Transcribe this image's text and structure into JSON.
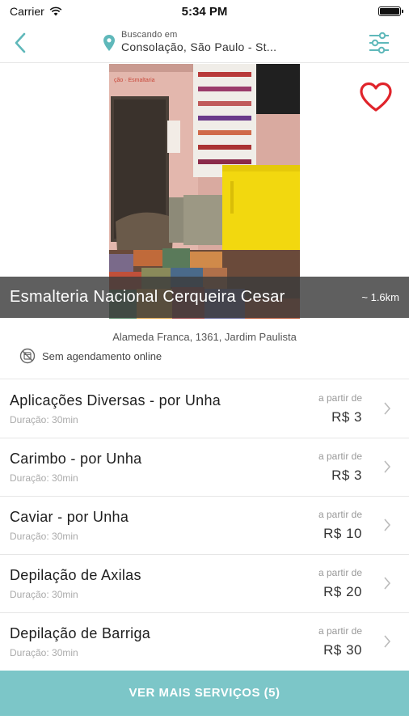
{
  "status_bar": {
    "carrier": "Carrier",
    "time": "5:34 PM"
  },
  "nav": {
    "location_label": "Buscando em",
    "location_value": "Consolação, São Paulo - St...",
    "accent_color": "#5fb8ba"
  },
  "salon": {
    "name": "Esmalteria Nacional Cerqueira Cesar",
    "distance": "~ 1.6km",
    "address": "Alameda Franca, 1361, Jardim Paulista",
    "booking_status": "Sem agendamento online",
    "favorite_color": "#e0242b"
  },
  "services": [
    {
      "name": "Aplicações Diversas - por Unha",
      "duration": "Duração: 30min",
      "from_label": "a partir de",
      "price": "R$ 3"
    },
    {
      "name": "Carimbo - por Unha",
      "duration": "Duração: 30min",
      "from_label": "a partir de",
      "price": "R$ 3"
    },
    {
      "name": "Caviar - por Unha",
      "duration": "Duração: 30min",
      "from_label": "a partir de",
      "price": "R$ 10"
    },
    {
      "name": "Depilação de Axilas",
      "duration": "Duração: 30min",
      "from_label": "a partir de",
      "price": "R$ 20"
    },
    {
      "name": "Depilação de Barriga",
      "duration": "Duração: 30min",
      "from_label": "a partir de",
      "price": "R$ 30"
    }
  ],
  "more_button": {
    "label": "VER MAIS SERVIÇOS (5)",
    "color": "#7cc6c8"
  }
}
